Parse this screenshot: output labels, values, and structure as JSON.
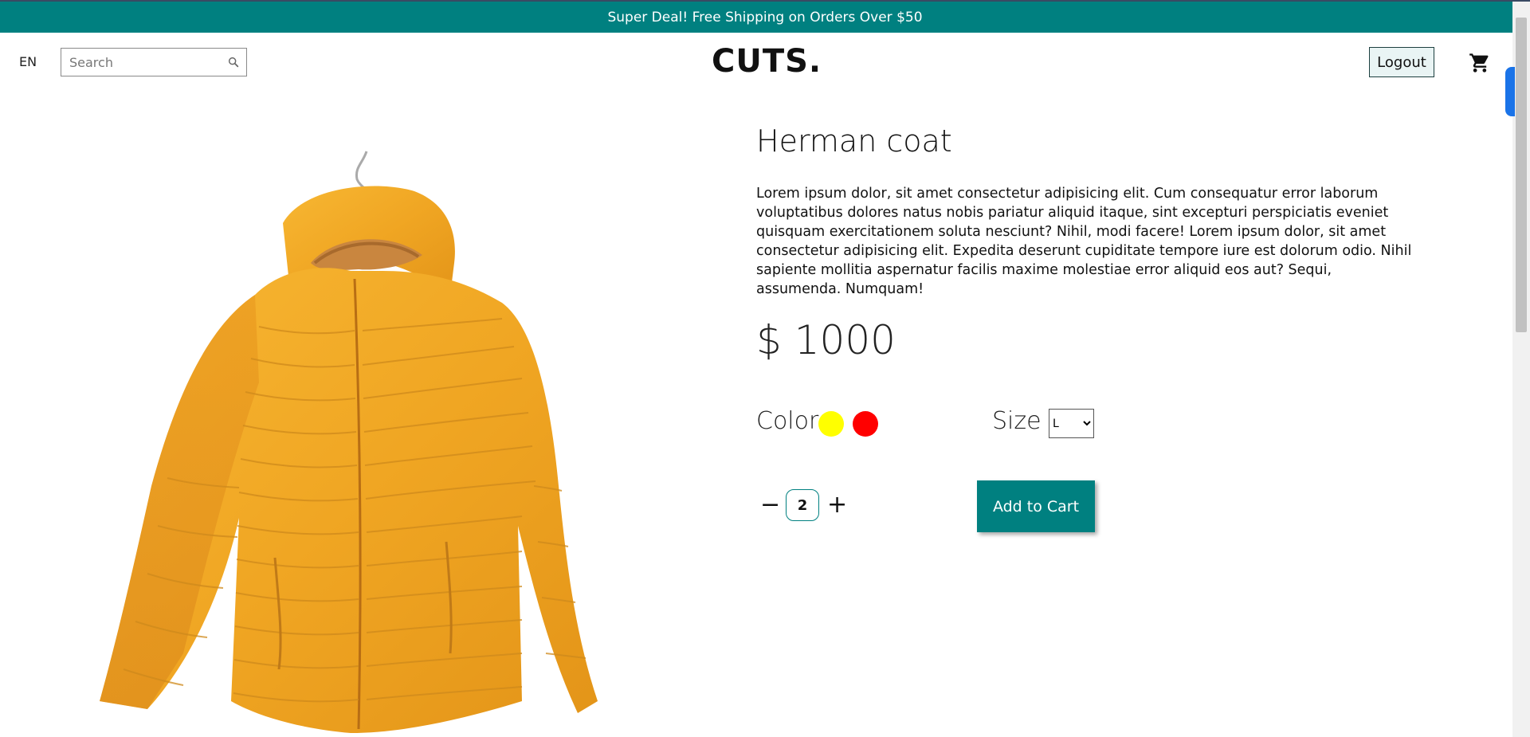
{
  "announcement": {
    "text": "Super Deal! Free Shipping on Orders Over $50"
  },
  "nav": {
    "language": "EN",
    "search_placeholder": "Search",
    "logo": "CUTS.",
    "logout_label": "Logout",
    "cart_icon": "cart-icon"
  },
  "product": {
    "title": "Herman coat",
    "description": "Lorem ipsum dolor, sit amet consectetur adipisicing elit. Cum consequatur error laborum voluptatibus dolores natus nobis pariatur aliquid itaque, sint excepturi perspiciatis eveniet quisquam exercitationem soluta nesciunt? Nihil, modi facere! Lorem ipsum dolor, sit amet consectetur adipisicing elit. Expedita deserunt cupiditate tempore iure est dolorum odio. Nihil sapiente mollitia aspernatur facilis maxime molestiae error aliquid eos aut? Sequi, assumenda. Numquam!",
    "price": "$ 1000",
    "color_label": "Color",
    "colors": [
      "#ffff00",
      "#ff0000"
    ],
    "size_label": "Size",
    "size_selected": "L",
    "quantity": "2",
    "minus_symbol": "−",
    "plus_symbol": "+",
    "add_to_cart_label": "Add to Cart",
    "image_icon": "yellow-puffer-jacket-image"
  },
  "colors": {
    "brand": "#008080",
    "announcement_text": "#ffffff"
  }
}
